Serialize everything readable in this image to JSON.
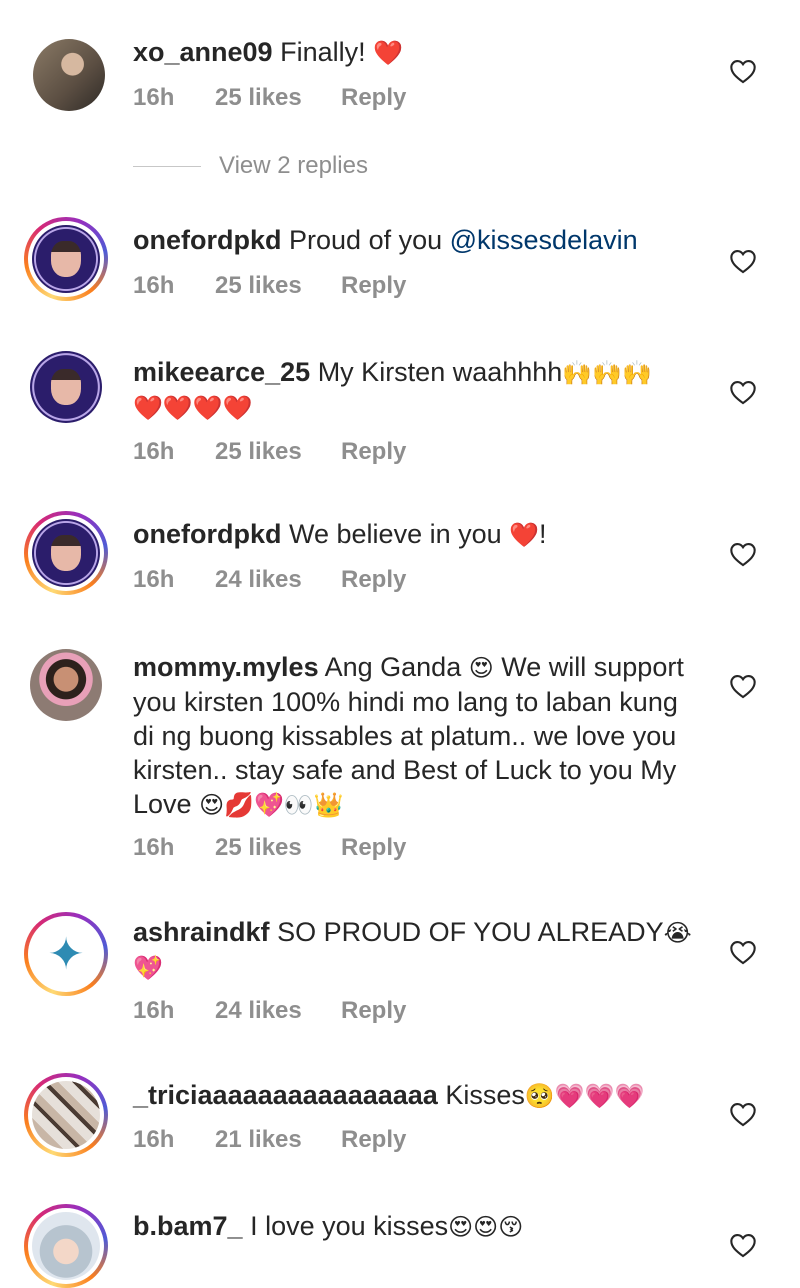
{
  "comments": [
    {
      "username": "xo_anne09",
      "text": "Finally! ",
      "emoji": "❤️",
      "time": "16h",
      "likes": "25 likes",
      "reply": "Reply",
      "avatar": "photo"
    },
    {
      "username": "onefordpkd",
      "text": "Proud of you ",
      "mention": "@kissesdelavin",
      "time": "16h",
      "likes": "25 likes",
      "reply": "Reply",
      "avatar": "badge"
    },
    {
      "username": "mikeearce_25",
      "text": "My Kirsten waahhhh",
      "emoji": "🙌🙌🙌",
      "line2": "❤️❤️❤️❤️",
      "time": "16h",
      "likes": "25 likes",
      "reply": "Reply",
      "avatar": "badge"
    },
    {
      "username": "onefordpkd",
      "text": "We believe in you ",
      "emoji": "❤️",
      "tail": "!",
      "time": "16h",
      "likes": "24 likes",
      "reply": "Reply",
      "avatar": "badge"
    },
    {
      "username": "mommy.myles",
      "text": "Ang Ganda ",
      "emoji": "😍",
      "text2": " We will support you kirsten 100% hindi mo lang to laban kung di ng buong kissables at platum.. we love you kirsten.. stay safe and Best of Luck to you My Love ",
      "emoji2": "😍💋💖👀👑",
      "time": "16h",
      "likes": "25 likes",
      "reply": "Reply",
      "avatar": "photo"
    },
    {
      "username": "ashraindkf",
      "text": "SO PROUD OF YOU ALREADY",
      "emoji": "😭",
      "line2": "💖",
      "time": "16h",
      "likes": "24 likes",
      "reply": "Reply",
      "avatar": "mermaid"
    },
    {
      "username": "_triciaaaaaaaaaaaaaaaa",
      "text": "Kisses",
      "emoji": "🥺💗💗💗",
      "time": "16h",
      "likes": "21 likes",
      "reply": "Reply",
      "avatar": "collage"
    },
    {
      "username": "b.bam7_",
      "text": "I love you kisses",
      "emoji": "😍😍😚",
      "avatar": "anime"
    }
  ],
  "view_replies": "View 2 replies",
  "colors": {
    "text": "#262626",
    "meta": "#8e8e8e",
    "mention": "#00376b"
  },
  "icons": {
    "like": "heart-outline-icon"
  }
}
